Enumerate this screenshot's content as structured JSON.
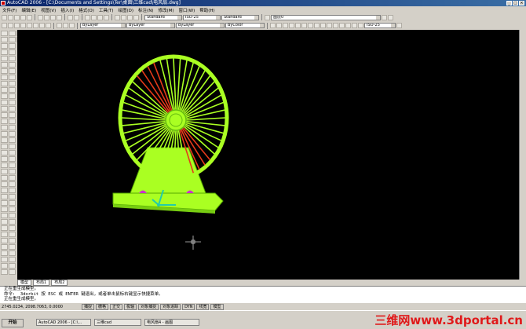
{
  "window": {
    "title": "AutoCAD 2006 - [C:\\Documents and Settings\\Ter\\桌面\\三维cad\\电风扇.dwg]"
  },
  "menu": [
    "文件(F)",
    "编辑(E)",
    "视图(V)",
    "插入(I)",
    "格式(O)",
    "工具(T)",
    "绘图(D)",
    "标注(N)",
    "修改(M)",
    "窗口(W)",
    "帮助(H)"
  ],
  "toolbar": {
    "text_style": "Standard",
    "dim_style": "ISO-25",
    "table_style": "Standard",
    "layer": "图层0",
    "color": "ByLayer",
    "linetype": "ByLayer",
    "lineweight": "ByLayer",
    "plot_style": "ByColor",
    "dim_style_right": "ISO-25"
  },
  "layout_tabs": [
    "模型",
    "布局1",
    "布局2"
  ],
  "command_lines": [
    "正在重生成模型。",
    "命令: _3dorbit 按 ESC 或 ENTER 键退出，或者单击鼠标右键显示快捷菜单。",
    "正在重生成模型。"
  ],
  "status": {
    "coords": "2745.0234, 2098.7063, 0.0000",
    "buttons": [
      "捕捉",
      "栅格",
      "正交",
      "极轴",
      "对象捕捉",
      "对象追踪",
      "DYN",
      "线宽",
      "模型"
    ]
  },
  "taskbar": {
    "start": "开始",
    "items": [
      "AutoCAD 2006 - [C:\\...",
      "三维cad",
      "电风扇4 - 画图"
    ]
  },
  "watermark": "三维网www.3dportal.cn",
  "colors": {
    "model": "#aaff22",
    "accent": "#e53a1a",
    "handle": "#cc33cc",
    "gizmo": "#22ccaa"
  }
}
